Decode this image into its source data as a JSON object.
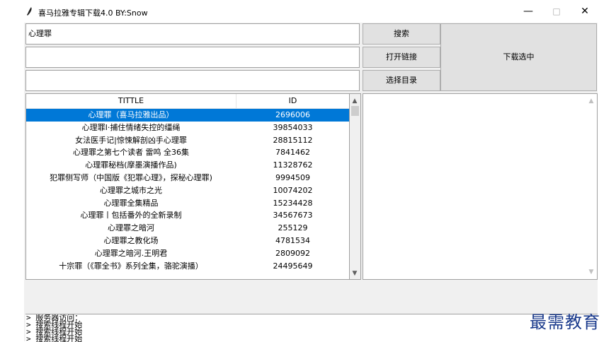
{
  "window": {
    "title": "喜马拉雅专辑下载4.0 BY:Snow",
    "controls": {
      "minimize": "—",
      "maximize": "□",
      "close": "✕"
    }
  },
  "inputs": {
    "search": "心理罪",
    "link": "",
    "directory": ""
  },
  "buttons": {
    "search": "搜索",
    "open_link": "打开链接",
    "choose_dir": "选择目录",
    "download_selected": "下载选中"
  },
  "table": {
    "columns": [
      "TITTLE",
      "ID"
    ],
    "rows": [
      {
        "title": "心理罪（喜马拉雅出品）",
        "id": "2696006",
        "selected": true
      },
      {
        "title": "心理罪Ⅰ·捕住情绪失控的缰绳",
        "id": "39854033"
      },
      {
        "title": "女法医手记|惊悚解剖凶手心理罪",
        "id": "28815112"
      },
      {
        "title": "心理罪之第七个读者 雷鸣 全36集",
        "id": "7841462"
      },
      {
        "title": "心理罪秘档(摩墨演播作品)",
        "id": "11328762"
      },
      {
        "title": "犯罪侧写师（中国版《犯罪心理》，探秘心理罪)",
        "id": "9994509"
      },
      {
        "title": "心理罪之城市之光",
        "id": "10074202"
      },
      {
        "title": "心理罪全集精品",
        "id": "15234428"
      },
      {
        "title": "心理罪丨包括番外的全新录制",
        "id": "34567673"
      },
      {
        "title": "心理罪之暗河",
        "id": "255129"
      },
      {
        "title": "心理罪之教化场",
        "id": "4781534"
      },
      {
        "title": "心理罪之暗河.王明君",
        "id": "2809092"
      },
      {
        "title": "十宗罪（《罪全书》系列全集，骆驼演播）",
        "id": "24495649"
      }
    ]
  },
  "log": {
    "lines": [
      "> 服务器访问：",
      "> 搜索线程开始",
      "> 搜索线程开始",
      "> 搜索线程开始"
    ]
  },
  "watermark": "最需教育",
  "colors": {
    "selection": "#0078d7",
    "button_bg": "#e1e1e1",
    "client_bg": "#f0f0f0"
  }
}
